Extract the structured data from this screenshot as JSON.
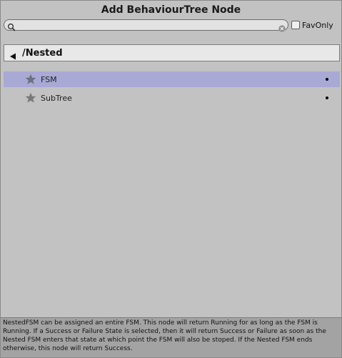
{
  "window": {
    "title": "Add BehaviourTree Node"
  },
  "search": {
    "value": "",
    "placeholder": "",
    "icon": "search-icon",
    "clear_icon": "clear-icon"
  },
  "fav_only": {
    "label": "FavOnly",
    "checked": false
  },
  "navigation": {
    "back_icon": "back-arrow-icon",
    "title": "/Nested"
  },
  "items": [
    {
      "label": "FSM",
      "icon": "star-icon",
      "selected": true
    },
    {
      "label": "SubTree",
      "icon": "star-icon",
      "selected": false
    }
  ],
  "description": {
    "text": "NestedFSM can be assigned an entire FSM. This node will return Running for as long as the FSM is Running. If a Success or Failure State is selected, then it will return Success or Failure as soon as the Nested FSM enters that state at which point the FSM will also be stoped. If the Nested FSM ends otherwise, this node will return Success."
  },
  "colors": {
    "background": "#c2c2c2",
    "selected_row": "#a9a9d6",
    "header_bg": "#e8e8e8",
    "description_bg": "#a3a3a3"
  }
}
